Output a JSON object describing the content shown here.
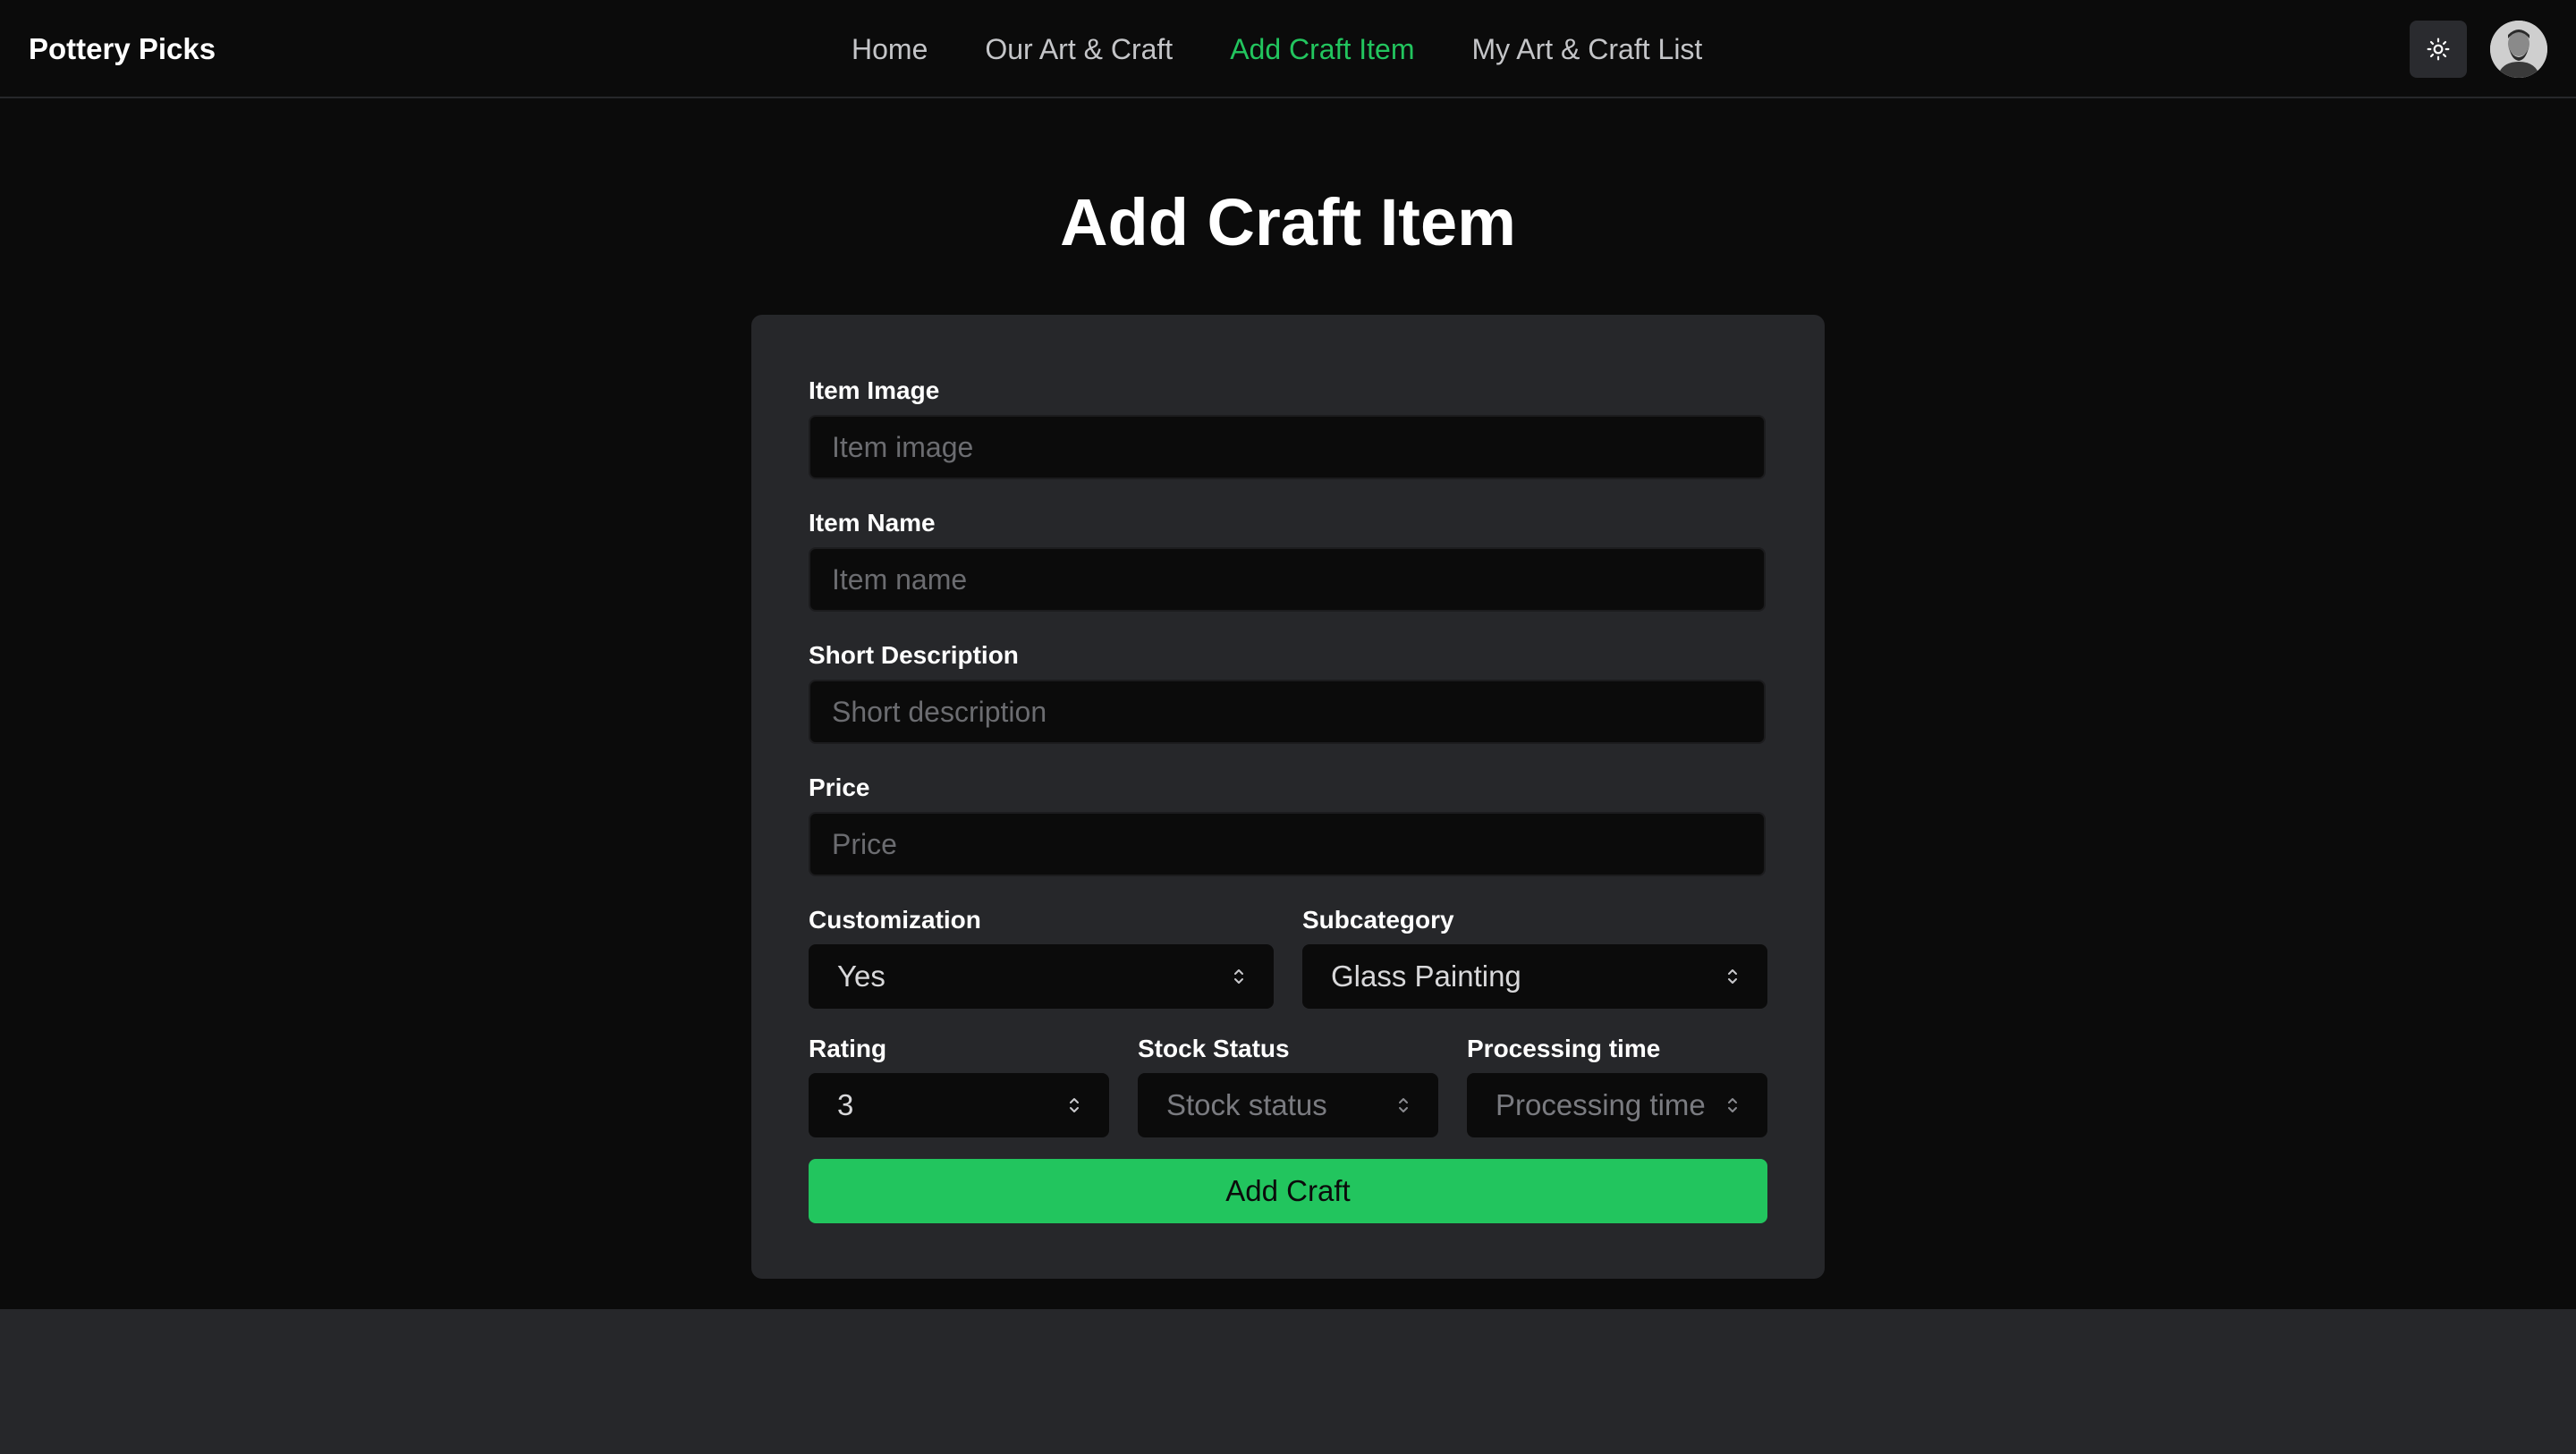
{
  "navbar": {
    "brand": "Pottery Picks",
    "links": [
      {
        "label": "Home",
        "active": false
      },
      {
        "label": "Our Art & Craft",
        "active": false
      },
      {
        "label": "Add Craft Item",
        "active": true
      },
      {
        "label": "My Art & Craft List",
        "active": false
      }
    ],
    "theme_icon": "sun-icon",
    "accent_color": "#22c55e"
  },
  "page": {
    "title": "Add Craft Item"
  },
  "form": {
    "item_image": {
      "label": "Item Image",
      "placeholder": "Item image",
      "value": ""
    },
    "item_name": {
      "label": "Item Name",
      "placeholder": "Item name",
      "value": ""
    },
    "short_description": {
      "label": "Short Description",
      "placeholder": "Short description",
      "value": ""
    },
    "price": {
      "label": "Price",
      "placeholder": "Price",
      "value": ""
    },
    "customization": {
      "label": "Customization",
      "value": "Yes"
    },
    "subcategory": {
      "label": "Subcategory",
      "value": "Glass Painting"
    },
    "rating": {
      "label": "Rating",
      "value": "3"
    },
    "stock_status": {
      "label": "Stock Status",
      "value": "Stock status"
    },
    "processing_time": {
      "label": "Processing time",
      "value": "Processing time"
    },
    "submit_label": "Add Craft",
    "submit_color": "#22c55e"
  }
}
